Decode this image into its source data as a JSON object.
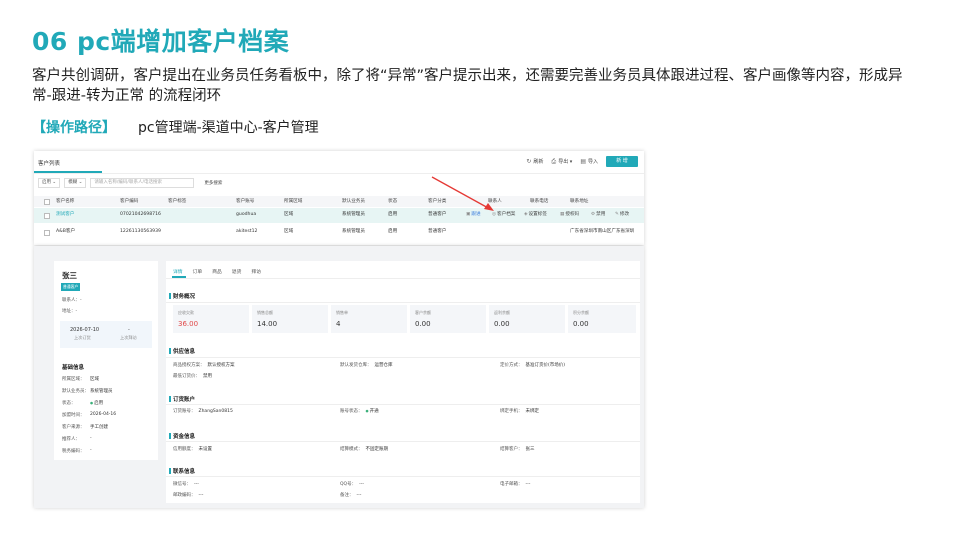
{
  "slide": {
    "title": "06  pc端增加客户档案",
    "description": "客户共创调研，客户提出在业务员任务看板中，除了将“异常”客户提示出来，还需要完善业务员具体跟进过程、客户画像等内容，形成异常-跟进-转为正常 的流程闭环",
    "path_tag": "【操作路径】",
    "path_value": "pc管理端-渠道中心-客户管理"
  },
  "list": {
    "tab": "客户列表",
    "actions": {
      "refresh": "刷新",
      "export": "导出",
      "import": "导入",
      "new": "新 增"
    },
    "filter": {
      "status": "启用",
      "field": "模糊",
      "placeholder": "请输入名称/编码/联系人/电话搜索",
      "more": "更多搜索"
    },
    "columns": [
      "客户名称",
      "客户编码",
      "客户标签",
      "客户账号",
      "所属区域",
      "默认业务员",
      "状态",
      "客户分类",
      "联系人",
      "联系电话",
      "联系地址"
    ],
    "rows": [
      {
        "name": "测试客户",
        "code": "07021042698716",
        "label": "",
        "account": "guodhua",
        "region": "区域",
        "sales": "系统管理员",
        "status": "启用",
        "category": "普通客户",
        "ops": {
          "follow": "跟进",
          "archive": "客户档案",
          "tag": "设置标签",
          "qr": "授权码",
          "disable": "禁用",
          "edit": "修改"
        }
      },
      {
        "name": "A&B客户",
        "code": "12261130563939",
        "label": "",
        "account": "akitest12",
        "region": "区域",
        "sales": "系统管理员",
        "status": "启用",
        "category": "普通客户",
        "address": "广东省深圳市南山区广东省深圳"
      }
    ]
  },
  "detail": {
    "name": "张三",
    "badge": "普通客户",
    "contact": "联系人：-",
    "address": "地址：-",
    "last_order_date": "2026-07-10",
    "last_order_label": "上次订货",
    "last_visit_value": "-",
    "last_visit_label": "上次拜访",
    "basic_title": "基础信息",
    "basic": [
      {
        "k": "所属区域：",
        "v": "区域"
      },
      {
        "k": "默认业务员：",
        "v": "系统管理员"
      },
      {
        "k": "状态：",
        "v": "启用"
      },
      {
        "k": "加盟时间：",
        "v": "2026-04-16"
      },
      {
        "k": "客户来源：",
        "v": "手工创建"
      },
      {
        "k": "推荐人：",
        "v": "-"
      },
      {
        "k": "税务编码：",
        "v": "-"
      }
    ],
    "tabs": [
      "详情",
      "订单",
      "商品",
      "退货",
      "拜访"
    ],
    "finance_title": "财务概况",
    "metrics": [
      {
        "label": "应收欠款",
        "value": "36.00"
      },
      {
        "label": "销售总额",
        "value": "14.00"
      },
      {
        "label": "销售单",
        "value": "4"
      },
      {
        "label": "客户余额",
        "value": "0.00"
      },
      {
        "label": "返利余额",
        "value": "0.00"
      },
      {
        "label": "积分余额",
        "value": "0.00"
      }
    ],
    "supply_title": "供应信息",
    "supply": {
      "plan": {
        "k": "商品授权方案：",
        "v": "默认授权方案"
      },
      "warehouse": {
        "k": "默认发货仓库：",
        "v": "运营仓库"
      },
      "price": {
        "k": "定价方式：",
        "v": "基准订货价(市场价)"
      },
      "min_order": {
        "k": "最低订货价：",
        "v": "禁用"
      }
    },
    "account_title": "订货账户",
    "account": {
      "acct": {
        "k": "订货账号：",
        "v": "ZhangSan0815"
      },
      "state": {
        "k": "账号状态：",
        "v": "开通"
      },
      "phone": {
        "k": "绑定手机：",
        "v": "未绑定"
      }
    },
    "funds_title": "资金信息",
    "funds": {
      "limit": {
        "k": "信用额度：",
        "v": "未设置"
      },
      "mode": {
        "k": "结算模式：",
        "v": "不固定账期"
      },
      "client": {
        "k": "结算客户：",
        "v": "张三"
      }
    },
    "contact_title": "联系信息",
    "contact_info": {
      "wechat": {
        "k": "微信号：",
        "v": "---"
      },
      "qq": {
        "k": "QQ号：",
        "v": "---"
      },
      "email": {
        "k": "电子邮箱：",
        "v": "---"
      },
      "zip": {
        "k": "邮政编码：",
        "v": "---"
      },
      "note": {
        "k": "备注：",
        "v": "---"
      }
    }
  },
  "colors": {
    "accent": "#21a9b8",
    "arrow": "#e53935",
    "negative": "#e14848"
  }
}
